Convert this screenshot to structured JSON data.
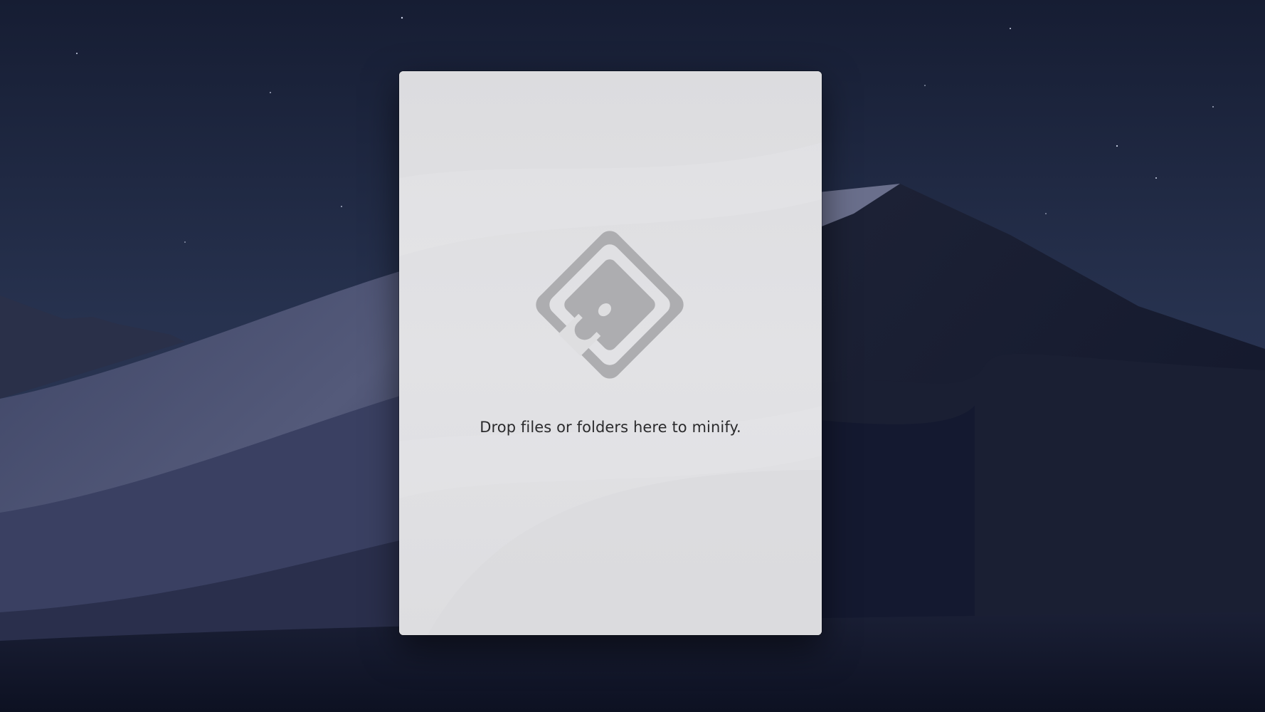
{
  "desktop": {
    "wallpaper_icon": "desert-dunes-night-wallpaper"
  },
  "window": {
    "icon": "minify-app-icon",
    "drop_prompt": "Drop files or folders here to minify.",
    "colors": {
      "background": "#dedee0",
      "icon": "#adadb0",
      "text": "#2b2b2d"
    }
  }
}
